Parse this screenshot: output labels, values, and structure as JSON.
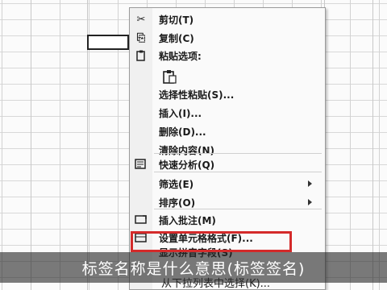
{
  "menu": {
    "items": [
      {
        "icon": "scissors-icon",
        "glyph": "✂",
        "label": "剪切(T)"
      },
      {
        "icon": "copy-icon",
        "glyph": "⎘",
        "label": "复制(C)"
      },
      {
        "icon": "paste-icon",
        "glyph": "📋",
        "label": "粘贴选项:"
      },
      {
        "icon": "",
        "glyph": "",
        "label": ""
      },
      {
        "icon": "",
        "glyph": "",
        "label": "选择性粘贴(S)..."
      },
      {
        "icon": "",
        "glyph": "",
        "label": "插入(I)..."
      },
      {
        "icon": "",
        "glyph": "",
        "label": "删除(D)..."
      },
      {
        "icon": "",
        "glyph": "",
        "label": "清除内容(N)"
      },
      {
        "icon": "quick-analysis-icon",
        "glyph": "▤",
        "label": "快速分析(Q)"
      },
      {
        "icon": "",
        "glyph": "",
        "label": "筛选(E)"
      },
      {
        "icon": "",
        "glyph": "",
        "label": "排序(O)"
      },
      {
        "icon": "comment-icon",
        "glyph": "▭",
        "label": "插入批注(M)"
      },
      {
        "icon": "format-cells-icon",
        "glyph": "▦",
        "label": "设置单元格格式(F)..."
      },
      {
        "icon": "",
        "glyph": "",
        "label": "显示拼音字段(S)"
      }
    ]
  },
  "bottom_item": "从下拉列表中选择(K)...",
  "caption": "标签名称是什么意思(标签签名)"
}
